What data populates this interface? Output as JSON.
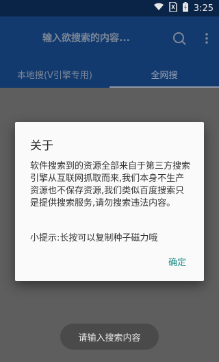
{
  "status_bar": {
    "time": "3:25",
    "icons": [
      "wifi-icon",
      "no-sim-icon",
      "battery-charging-icon"
    ]
  },
  "toolbar": {
    "search_placeholder": "输入欲搜索的内容...",
    "search_icon": "search-icon",
    "more_icon": "more-vert-icon"
  },
  "tabs": [
    {
      "label": "本地搜(V引擎专用)",
      "selected": false
    },
    {
      "label": "全网搜",
      "selected": true
    }
  ],
  "dialog": {
    "title": "关于",
    "body": "软件搜索到的资源全部来自于第三方搜索引擎从互联网抓取而来,我们本身不生产资源也不保存资源,我们类似百度搜索只是提供搜索服务,请勿搜索违法内容。",
    "tip": "小提示:长按可以复制种子磁力哦",
    "ok_label": "确定",
    "accent_color": "#1e8e86"
  },
  "toast": {
    "text": "请输入搜索内容"
  }
}
